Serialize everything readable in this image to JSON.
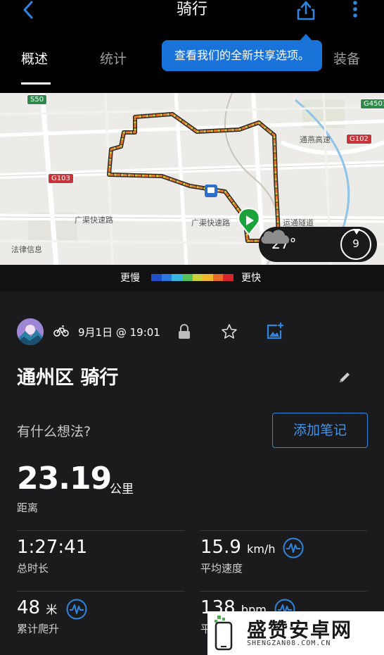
{
  "header": {
    "title": "骑行"
  },
  "tabs": [
    {
      "label": "概述",
      "active": true
    },
    {
      "label": "统计",
      "active": false
    },
    {
      "label": "装备",
      "active": false
    }
  ],
  "tooltip": "查看我们的全新共享选项。",
  "map": {
    "labels": [
      "通燕高速",
      "广渠快速路",
      "广渠快速路",
      "运通隧道",
      "法律信息"
    ],
    "road_badges": [
      "S50",
      "G4501",
      "G102",
      "G103"
    ],
    "weather": {
      "temperature": "27°",
      "wind_speed": "9",
      "icon": "cloud-icon"
    }
  },
  "legend": {
    "slow_label": "更慢",
    "fast_label": "更快",
    "colors": [
      "#1f4fc9",
      "#2a78e0",
      "#36b6e0",
      "#55c35a",
      "#c9d23b",
      "#f0b82d",
      "#ea6a2a",
      "#d8262a"
    ]
  },
  "activity": {
    "type_icon": "bike-icon",
    "date": "9月1日 @ 19:01",
    "title": "通州区 骑行",
    "thoughts_prompt": "有什么想法?",
    "add_note_label": "添加笔记",
    "distance": {
      "value": "23.19",
      "unit": "公里",
      "label": "距离"
    },
    "stats": [
      {
        "value": "1:27:41",
        "unit": "",
        "label": "总时长"
      },
      {
        "value": "15.9",
        "unit": "km/h",
        "label": "平均速度"
      },
      {
        "value": "48",
        "unit": "米",
        "label": "累计爬升"
      },
      {
        "value": "138",
        "unit": "bpm",
        "label": "平"
      }
    ]
  },
  "watermark": {
    "title": "盛赞安卓网",
    "subtitle": "SHENGZAN08.COM.CN"
  },
  "colors": {
    "accent": "#2f86e0",
    "background": "#1b1b1d"
  }
}
